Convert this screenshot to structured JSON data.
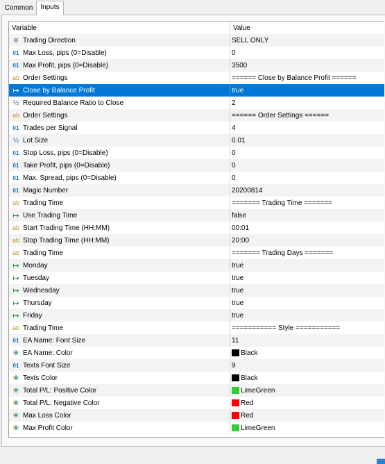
{
  "tabs": [
    {
      "label": "Common",
      "active": false
    },
    {
      "label": "Inputs",
      "active": true
    }
  ],
  "columns": {
    "variable": "Variable",
    "value": "Value"
  },
  "selected_index": 4,
  "rows": [
    {
      "icon": "enum-icon",
      "type": "enum",
      "variable": "Trading Direction",
      "value": "SELL ONLY"
    },
    {
      "icon": "integer-icon",
      "type": "int",
      "variable": "Max Loss, pips (0=Disable)",
      "value": "0"
    },
    {
      "icon": "integer-icon",
      "type": "int",
      "variable": "Max Profit, pips (0=Disable)",
      "value": "3500"
    },
    {
      "icon": "string-icon",
      "type": "string",
      "variable": "Order Settings",
      "value": "====== Close by Balance Profit ======"
    },
    {
      "icon": "boolean-icon",
      "type": "bool",
      "variable": "Close by Balance Profit",
      "value": "true"
    },
    {
      "icon": "double-icon",
      "type": "double",
      "variable": "Required Balance Ratio to Close",
      "value": "2"
    },
    {
      "icon": "string-icon",
      "type": "string",
      "variable": "Order Settings",
      "value": "====== Order Settings ======"
    },
    {
      "icon": "integer-icon",
      "type": "int",
      "variable": "Trades per Signal",
      "value": "4"
    },
    {
      "icon": "double-icon",
      "type": "double",
      "variable": "Lot Size",
      "value": "0.01"
    },
    {
      "icon": "integer-icon",
      "type": "int",
      "variable": "Stop Loss, pips (0=Disable)",
      "value": "0"
    },
    {
      "icon": "integer-icon",
      "type": "int",
      "variable": "Take Profit, pips (0=Disable)",
      "value": "0"
    },
    {
      "icon": "integer-icon",
      "type": "int",
      "variable": "Max. Spread, pips (0=Disable)",
      "value": "0"
    },
    {
      "icon": "integer-icon",
      "type": "int",
      "variable": "Magic Number",
      "value": "20200814"
    },
    {
      "icon": "string-icon",
      "type": "string",
      "variable": "Trading Time",
      "value": "======= Trading Time ======="
    },
    {
      "icon": "boolean-icon",
      "type": "bool",
      "variable": "Use Trading Time",
      "value": "false"
    },
    {
      "icon": "string-icon",
      "type": "string",
      "variable": "Start Trading Time (HH:MM)",
      "value": "00:01"
    },
    {
      "icon": "string-icon",
      "type": "string",
      "variable": "Stop Trading Time (HH:MM)",
      "value": "20:00"
    },
    {
      "icon": "string-icon",
      "type": "string",
      "variable": "Trading Time",
      "value": "======= Trading Days ======="
    },
    {
      "icon": "boolean-icon",
      "type": "bool",
      "variable": "Monday",
      "value": "true"
    },
    {
      "icon": "boolean-icon",
      "type": "bool",
      "variable": "Tuesday",
      "value": "true"
    },
    {
      "icon": "boolean-icon",
      "type": "bool",
      "variable": "Wednesday",
      "value": "true"
    },
    {
      "icon": "boolean-icon",
      "type": "bool",
      "variable": "Thursday",
      "value": "true"
    },
    {
      "icon": "boolean-icon",
      "type": "bool",
      "variable": "Friday",
      "value": "true"
    },
    {
      "icon": "string-icon",
      "type": "string",
      "variable": "Trading Time",
      "value": "=========== Style ==========="
    },
    {
      "icon": "integer-icon",
      "type": "int",
      "variable": "EA Name: Font Size",
      "value": "11"
    },
    {
      "icon": "color-icon",
      "type": "color",
      "variable": "EA Name: Color",
      "value": "Black",
      "swatch": "#000000"
    },
    {
      "icon": "integer-icon",
      "type": "int",
      "variable": "Texts Font Size",
      "value": "9"
    },
    {
      "icon": "color-icon",
      "type": "color",
      "variable": "Texts Color",
      "value": "Black",
      "swatch": "#000000"
    },
    {
      "icon": "color-icon",
      "type": "color",
      "variable": "Total P/L: Positive Color",
      "value": "LimeGreen",
      "swatch": "#32cd32"
    },
    {
      "icon": "color-icon",
      "type": "color",
      "variable": "Total P/L: Negative Color",
      "value": "Red",
      "swatch": "#ff0000"
    },
    {
      "icon": "color-icon",
      "type": "color",
      "variable": "Max Loss Color",
      "value": "Red",
      "swatch": "#ff0000"
    },
    {
      "icon": "color-icon",
      "type": "color",
      "variable": "Max Profit Color",
      "value": "LimeGreen",
      "swatch": "#32cd32"
    }
  ],
  "colors": {
    "selection": "#0078d7",
    "alt_row": "#f3f3f3"
  }
}
